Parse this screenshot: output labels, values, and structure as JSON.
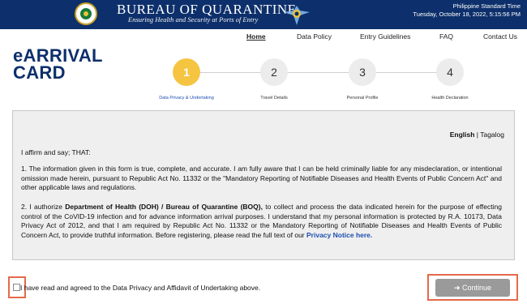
{
  "header": {
    "title": "BUREAU OF QUARANTINE",
    "subtitle": "Ensuring Health and Security at Ports of Entry",
    "time_label": "Philippine Standard Time",
    "time_value": "Tuesday, October 18, 2022, 5:15:56 PM"
  },
  "nav": {
    "items": [
      "Home",
      "Data Policy",
      "Entry Guidelines",
      "FAQ",
      "Contact Us"
    ]
  },
  "page": {
    "title_line1": "eARRIVAL",
    "title_line2": "CARD"
  },
  "stepper": {
    "steps": [
      {
        "number": "1",
        "label": "Data Privacy & Undertaking",
        "active": true
      },
      {
        "number": "2",
        "label": "Travel Details",
        "active": false
      },
      {
        "number": "3",
        "label": "Personal Profile",
        "active": false
      },
      {
        "number": "4",
        "label": "Health Declaration",
        "active": false
      }
    ]
  },
  "content": {
    "lang_active": "English",
    "lang_separator": "|",
    "lang_other": "Tagalog",
    "intro": "I affirm and say; THAT:",
    "para1": "1. The information given in this form is true, complete, and accurate. I am fully aware that I can be held criminally liable for any misdeclaration, or intentional omission made herein, pursuant to Republic Act No. 11332 or the \"Mandatory Reporting of Notifiable Diseases and Health Events of Public Concern Act\" and other applicable laws and regulations.",
    "para2_prefix": "2. I authorize ",
    "para2_bold": "Department of Health (DOH) / Bureau of Quarantine (BOQ),",
    "para2_rest": " to collect and process the data indicated herein for the purpose of effecting control of the CoVID-19 infection and for advance information arrival purposes. I understand that my personal information is protected by R.A. 10173, Data Privacy Act of 2012, and that I am required by Republic Act No. 11332 or the Mandatory Reporting of Notifiable Diseases and Health Events of Public Concern Act, to provide truthful information. Before registering, please read the full text of our ",
    "privacy_link": "Privacy Notice here."
  },
  "agreement": {
    "text": "I have read and agreed to the Data Privacy and Affidavit of Undertaking above.",
    "checked": false
  },
  "continue_button": {
    "icon": "arrow-right-icon",
    "label": "Continue"
  },
  "colors": {
    "header_bg": "#0d2f6b",
    "step_active": "#f5c542",
    "link": "#1d4fb3",
    "highlight": "#e46a4a",
    "button_disabled": "#9a9a9a"
  }
}
